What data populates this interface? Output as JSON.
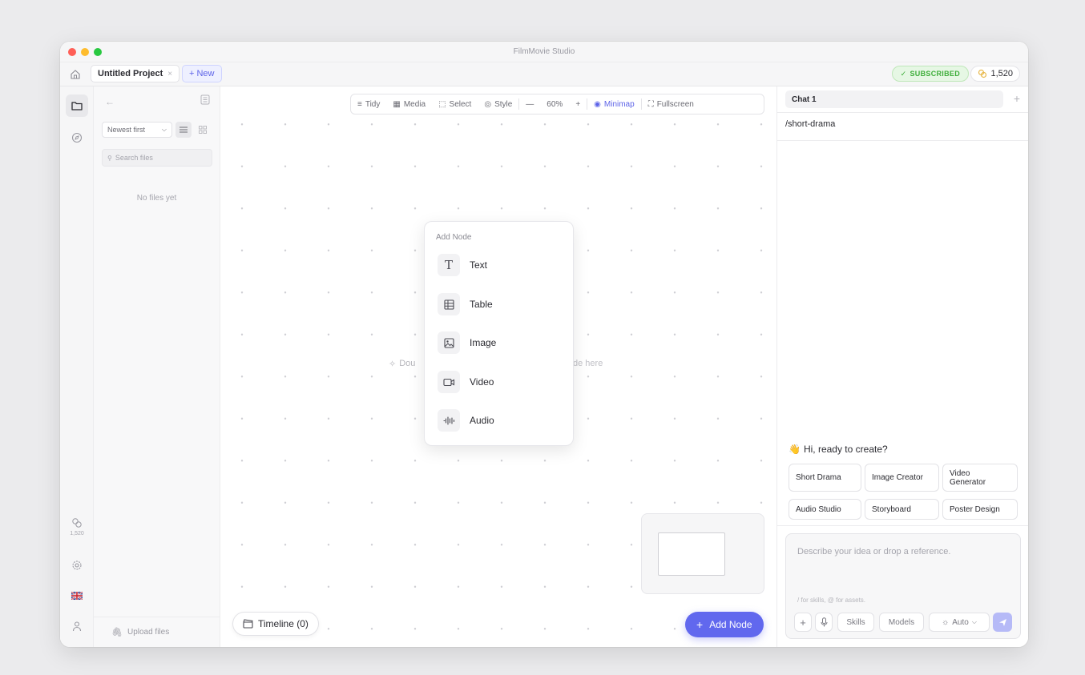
{
  "window": {
    "title": "FilmMovie Studio"
  },
  "tabs": {
    "project_label": "Untitled Project",
    "close_label": "×",
    "new_label": "+ New"
  },
  "status": {
    "subscribed": "SUBSCRIBED",
    "credits": "1,520"
  },
  "rail": {
    "credits": "1,520"
  },
  "files": {
    "sort_label": "Newest first",
    "search_placeholder": "Search files",
    "empty_text": "No files yet",
    "upload_label": "Upload files"
  },
  "toolbar": {
    "tidy": "Tidy",
    "media": "Media",
    "select": "Select",
    "style": "Style",
    "zoom": "60%",
    "minimap": "Minimap",
    "fullscreen": "Fullscreen"
  },
  "canvas": {
    "hint_start": "Dou",
    "hint_end": "de here"
  },
  "add_node_menu": {
    "title": "Add Node",
    "items": [
      {
        "label": "Text",
        "icon": "text-icon"
      },
      {
        "label": "Table",
        "icon": "table-icon"
      },
      {
        "label": "Image",
        "icon": "image-icon"
      },
      {
        "label": "Video",
        "icon": "video-icon"
      },
      {
        "label": "Audio",
        "icon": "audio-icon"
      }
    ]
  },
  "timeline": {
    "label": "Timeline (0)"
  },
  "add_node_button": {
    "label": "Add Node"
  },
  "chat": {
    "tab_label": "Chat 1",
    "command": "/short-drama",
    "greeting": "Hi, ready to create?",
    "chips": [
      "Short Drama",
      "Image Creator",
      "Video Generator",
      "Audio Studio",
      "Storyboard",
      "Poster Design"
    ],
    "input_placeholder": "Describe your idea or drop a reference.",
    "tip": "/ for skills, @ for assets.",
    "skills": "Skills",
    "models": "Models",
    "auto": "Auto"
  },
  "colors": {
    "accent": "#6168ee",
    "success": "#3eae3a"
  }
}
